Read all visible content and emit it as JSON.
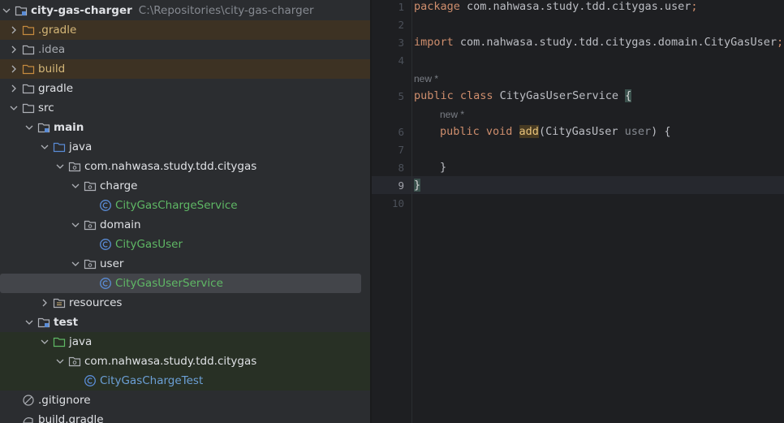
{
  "project": {
    "root_name": "city-gas-charger",
    "root_path": "C:\\Repositories\\city-gas-charger",
    "items": [
      {
        "label": ".gradle"
      },
      {
        "label": ".idea"
      },
      {
        "label": "build"
      },
      {
        "label": "gradle"
      },
      {
        "label": "src"
      },
      {
        "label": "main"
      },
      {
        "label": "java"
      },
      {
        "label": "com.nahwasa.study.tdd.citygas"
      },
      {
        "label": "charge"
      },
      {
        "label": "CityGasChargeService"
      },
      {
        "label": "domain"
      },
      {
        "label": "CityGasUser"
      },
      {
        "label": "user"
      },
      {
        "label": "CityGasUserService"
      },
      {
        "label": "resources"
      },
      {
        "label": "test"
      },
      {
        "label": "java"
      },
      {
        "label": "com.nahwasa.study.tdd.citygas"
      },
      {
        "label": "CityGasChargeTest"
      },
      {
        "label": ".gitignore"
      },
      {
        "label": "build.gradle"
      }
    ]
  },
  "editor": {
    "line_numbers": [
      "1",
      "2",
      "3",
      "4",
      "5",
      "6",
      "7",
      "8",
      "9",
      "10"
    ],
    "current_line": "9",
    "hints": {
      "class_hint": "new *",
      "method_hint": "new *"
    },
    "code": {
      "line1_kw": "package",
      "line1_rest": " com.nahwasa.study.tdd.citygas.user",
      "line1_semi": ";",
      "line3_kw": "import",
      "line3_rest": " com.nahwasa.study.tdd.citygas.domain.CityGasUser",
      "line3_semi": ";",
      "line5_kw": "public class",
      "line5_name": " CityGasUserService ",
      "line5_brace": "{",
      "line6_kw": "public void",
      "line6_sp": " ",
      "line6_fn": "add",
      "line6_open": "(CityGasUser ",
      "line6_param": "user",
      "line6_close": ") {",
      "line8_brace": "}",
      "line9_brace": "}"
    }
  },
  "colors": {
    "keyword": "#cf8e6d",
    "method_highlight": "#473a22",
    "test_folder": "#5fb865",
    "excluded_folder": "#d5b778"
  }
}
